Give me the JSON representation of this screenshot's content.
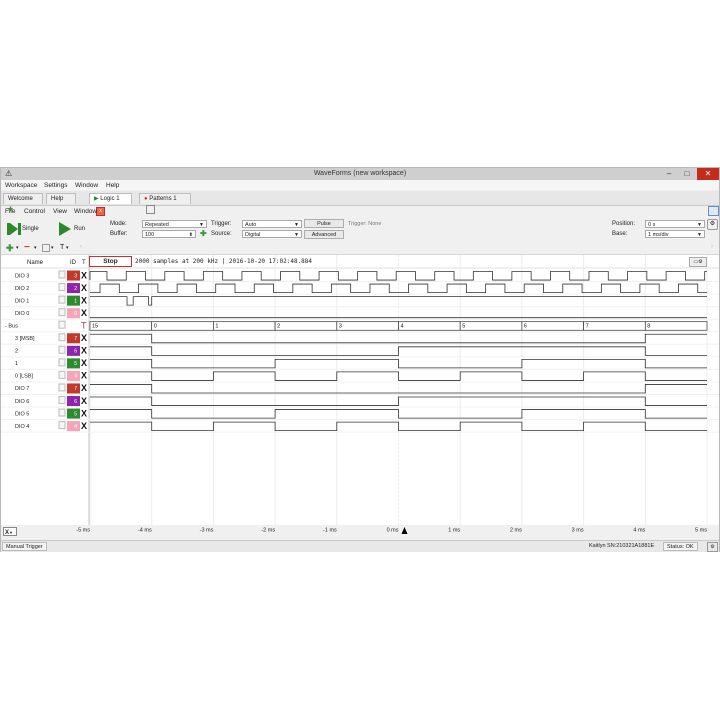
{
  "window": {
    "title": "WaveForms  (new workspace)",
    "minimize": "–",
    "maximize": "□",
    "close": "✕"
  },
  "menu": [
    "Workspace",
    "Settings",
    "Window",
    "Help"
  ],
  "tabs": [
    {
      "label": "Welcome"
    },
    {
      "label": "Help"
    },
    {
      "label": "Logic 1"
    },
    {
      "label": "Patterns 1"
    }
  ],
  "submenu": [
    "File",
    "Control",
    "View",
    "Window"
  ],
  "toolbar": {
    "single_label": "Single",
    "run_label": "Run",
    "mode_label": "Mode:",
    "mode_value": "Repeated",
    "buffer_label": "Buffer:",
    "buffer_value": "100",
    "trigger_label": "Trigger:",
    "trigger_value": "Auto",
    "source_label": "Source:",
    "source_value": "Digital",
    "pulse_label": "Pulse",
    "advanced_label": "Advanced",
    "trigger_status": "Trigger: None",
    "position_label": "Position:",
    "position_value": "0 s",
    "base_label": "Base:",
    "base_value": "1 ms/div"
  },
  "columns": {
    "name": "Name",
    "id": "ID",
    "t": "T"
  },
  "stop_label": "Stop",
  "acq_status": "2000 samples at 200 kHz | 2016-10-20 17:02:48.884",
  "channels": [
    {
      "name": "DIO 3",
      "id": "3",
      "trig": "X",
      "color": "#c0392b"
    },
    {
      "name": "DIO 2",
      "id": "2",
      "trig": "X",
      "color": "#8e24aa"
    },
    {
      "name": "DIO 1",
      "id": "1",
      "trig": "X",
      "color": "#2e8b2e"
    },
    {
      "name": "DIO 0",
      "id": "0",
      "trig": "X",
      "color": "#f5a5b8"
    },
    {
      "name": "- Bus",
      "id": "",
      "trig": "T",
      "color": ""
    },
    {
      "name": "3 [MSB]",
      "id": "7",
      "trig": "X",
      "color": "#c0392b"
    },
    {
      "name": "2",
      "id": "6",
      "trig": "X",
      "color": "#8e24aa"
    },
    {
      "name": "1",
      "id": "5",
      "trig": "X",
      "color": "#2e8b2e"
    },
    {
      "name": "0 [LSB]",
      "id": "4",
      "trig": "X",
      "color": "#f5a5b8"
    },
    {
      "name": "DIO 7",
      "id": "7",
      "trig": "X",
      "color": "#c0392b"
    },
    {
      "name": "DIO 6",
      "id": "6",
      "trig": "X",
      "color": "#8e24aa"
    },
    {
      "name": "DIO 5",
      "id": "5",
      "trig": "X",
      "color": "#2e8b2e"
    },
    {
      "name": "DIO 4",
      "id": "4",
      "trig": "X",
      "color": "#f5a5b8"
    }
  ],
  "bus_values": [
    "15",
    "0",
    "1",
    "2",
    "3",
    "4",
    "5",
    "6",
    "7",
    "8"
  ],
  "time_axis": [
    "-5 ms",
    "-4 ms",
    "-3 ms",
    "-2 ms",
    "-1 ms",
    "0 ms",
    "1 ms",
    "2 ms",
    "3 ms",
    "4 ms",
    "5 ms"
  ],
  "bottom_x_label": "X",
  "statusbar": {
    "manual_trigger": "Manual Trigger",
    "device": "Kaitlyn SN:210321A1881E",
    "status": "Status: OK"
  }
}
